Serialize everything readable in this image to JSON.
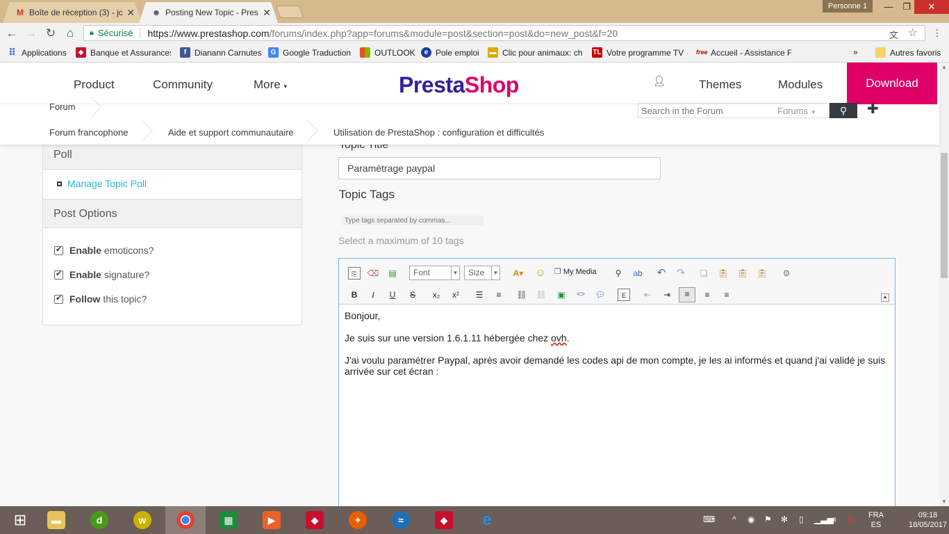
{
  "browser": {
    "tabs": [
      {
        "label": "Boîte de réception (3) - jc",
        "favicon": "gmail-icon"
      },
      {
        "label": "Posting New Topic - Pres",
        "favicon": "prestashop-icon"
      }
    ],
    "profile": "Personne 1",
    "secure_label": "Sécurisé",
    "url_host": "https://www.prestashop.com",
    "url_path": "/forums/index.php?app=forums&module=post&section=post&do=new_post&f=20",
    "bookmarks": [
      {
        "label": "Applications",
        "icon": "apps-grid-icon",
        "color": "#3c78d8"
      },
      {
        "label": "Banque et Assurances",
        "icon": "bank-icon",
        "color": "#c8102e"
      },
      {
        "label": "Dianann Carnutes",
        "icon": "facebook-icon",
        "color": "#3b5998"
      },
      {
        "label": "Google Traduction",
        "icon": "translate-icon",
        "color": "#4285f4"
      },
      {
        "label": "OUTLOOK",
        "icon": "windows-icon",
        "color": "#f25022"
      },
      {
        "label": "Pole emploi",
        "icon": "pole-emploi-icon",
        "color": "#1c3f94"
      },
      {
        "label": "Clic pour animaux: ch",
        "icon": "animal-icon",
        "color": "#e0a800"
      },
      {
        "label": "Votre programme TV",
        "icon": "tv-icon",
        "color": "#cc0000"
      },
      {
        "label": "Accueil - Assistance Fr",
        "icon": "free-icon",
        "color": "#cc0000"
      }
    ],
    "bookmarks_more": "»",
    "other_bookmarks": "Autres favoris"
  },
  "header": {
    "nav": [
      "Product",
      "Community",
      "More"
    ],
    "logo_part1": "Presta",
    "logo_part2": "Shop",
    "right_nav": [
      "Themes",
      "Modules"
    ],
    "download": "Download"
  },
  "breadcrumb": {
    "top": "Forum",
    "items": [
      "Forum francophone",
      "Aide et support communautaire",
      "Utilisation de PrestaShop : configuration et difficultés"
    ],
    "search_placeholder": "Search in the Forum",
    "scope": "Forums"
  },
  "sidebar": {
    "poll_title": "Poll",
    "manage_poll": "Manage Topic Poll",
    "post_options_title": "Post Options",
    "options": [
      {
        "bold": "Enable",
        "rest": "emoticons?"
      },
      {
        "bold": "Enable",
        "rest": "signature?"
      },
      {
        "bold": "Follow",
        "rest": "this topic?"
      }
    ]
  },
  "form": {
    "topic_title_label": "Topic Title",
    "topic_title_value": "Paramétrage paypal",
    "topic_tags_label": "Topic Tags",
    "tags_placeholder": "Type tags separated by commas...",
    "tags_hint": "Select a maximum of 10 tags"
  },
  "editor": {
    "font_label": "Font",
    "size_label": "Size",
    "my_media": "My Media",
    "body": {
      "p1": "Bonjour,",
      "p2_start": "Je suis sur une version 1.6.1.11 hébergée chez ",
      "p2_word": "ovh",
      "p2_end": ".",
      "p3": "J'ai voulu paramétrer Paypal, après avoir demandé les codes api de mon compte, je les ai informés et quand j'ai validé je suis arrivée sur cet écran :"
    }
  },
  "taskbar": {
    "lang_top": "FRA",
    "lang_bottom": "ES",
    "time": "09:18",
    "date": "18/05/2017"
  },
  "colors": {
    "brand_pink": "#df0067",
    "brand_purple": "#34209e",
    "link_blue": "#25b9d7"
  }
}
